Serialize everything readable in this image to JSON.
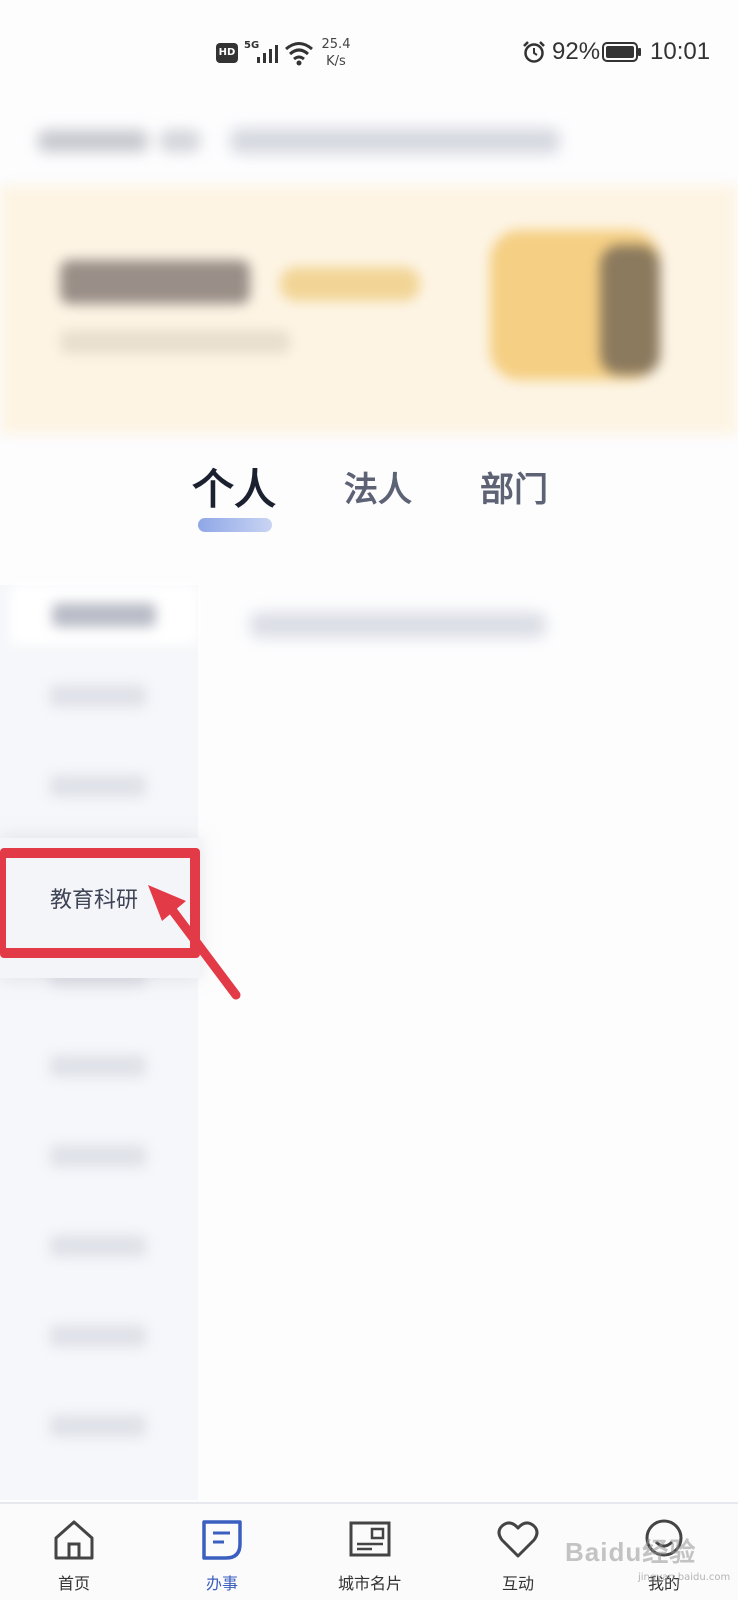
{
  "status_bar": {
    "hd_label": "HD",
    "network_label": "5G",
    "speed_value": "25.4",
    "speed_unit": "K/s",
    "battery_percent": "92%",
    "time": "10:01"
  },
  "tabs": [
    {
      "label": "个人",
      "active": true
    },
    {
      "label": "法人",
      "active": false
    },
    {
      "label": "部门",
      "active": false
    }
  ],
  "sidebar": {
    "highlighted_item": "教育科研"
  },
  "bottom_nav": [
    {
      "label": "首页",
      "icon": "home-icon",
      "active": false
    },
    {
      "label": "办事",
      "icon": "document-icon",
      "active": true
    },
    {
      "label": "城市名片",
      "icon": "city-card-icon",
      "active": false
    },
    {
      "label": "互动",
      "icon": "heart-icon",
      "active": false
    },
    {
      "label": "我的",
      "icon": "profile-icon",
      "active": false
    }
  ],
  "watermark": {
    "text": "Baidu经验",
    "sub": "jingyan.baidu.com"
  },
  "colors": {
    "accent": "#3b5fc0",
    "highlight_red": "#e33a48",
    "tab_underline": "#8fa7e6"
  }
}
